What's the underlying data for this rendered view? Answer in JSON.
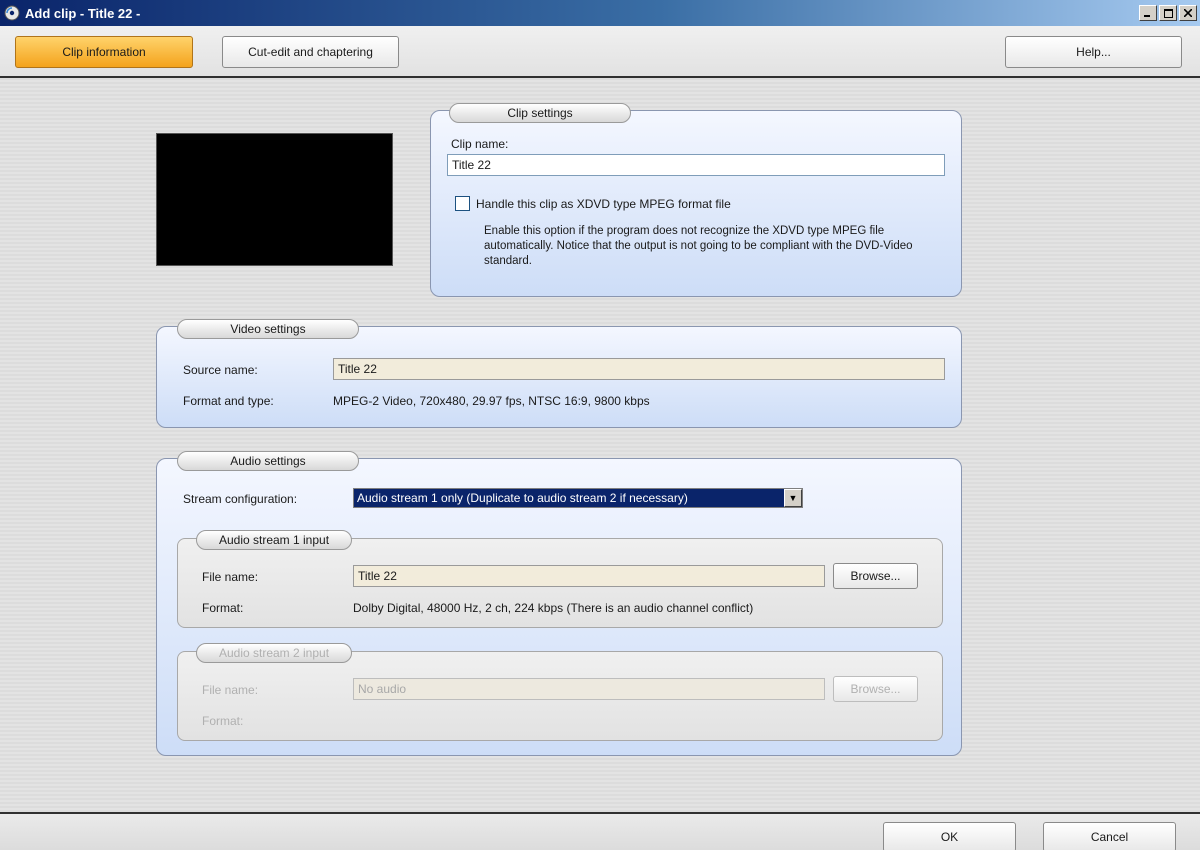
{
  "window": {
    "title": "Add clip - Title 22 -",
    "app_icon": "dvd-app-icon",
    "controls": [
      "minimize",
      "maximize",
      "close"
    ]
  },
  "toolbar": {
    "clip_info_label": "Clip information",
    "cut_edit_label": "Cut-edit and chaptering",
    "help_label": "Help..."
  },
  "clip_settings": {
    "title": "Clip settings",
    "clip_name_label": "Clip name:",
    "clip_name_value": "Title 22",
    "xdvd_checkbox_label": "Handle this clip as XDVD type MPEG format file",
    "xdvd_checked": false,
    "description": "Enable this option if the program does not recognize the XDVD type MPEG file automatically. Notice that the output is not going to be compliant with the DVD-Video standard."
  },
  "video_settings": {
    "title": "Video settings",
    "source_name_label": "Source name:",
    "source_name_value": "Title 22",
    "format_label": "Format and type:",
    "format_value": "MPEG-2 Video,  720x480,  29.97 fps,  NTSC 16:9,  9800 kbps"
  },
  "audio_settings": {
    "title": "Audio settings",
    "stream_config_label": "Stream configuration:",
    "stream_config_value": "Audio stream 1 only (Duplicate to audio stream 2 if necessary)",
    "stream1": {
      "title": "Audio stream 1 input",
      "file_name_label": "File name:",
      "file_name_value": "Title 22",
      "browse_label": "Browse...",
      "format_label": "Format:",
      "format_value": "Dolby Digital,  48000 Hz,  2 ch,  224 kbps  (There is an audio channel conflict)"
    },
    "stream2": {
      "title": "Audio stream 2 input",
      "file_name_label": "File name:",
      "file_name_value": "No audio",
      "browse_label": "Browse...",
      "format_label": "Format:",
      "enabled": false
    }
  },
  "footer": {
    "ok_label": "OK",
    "cancel_label": "Cancel"
  }
}
